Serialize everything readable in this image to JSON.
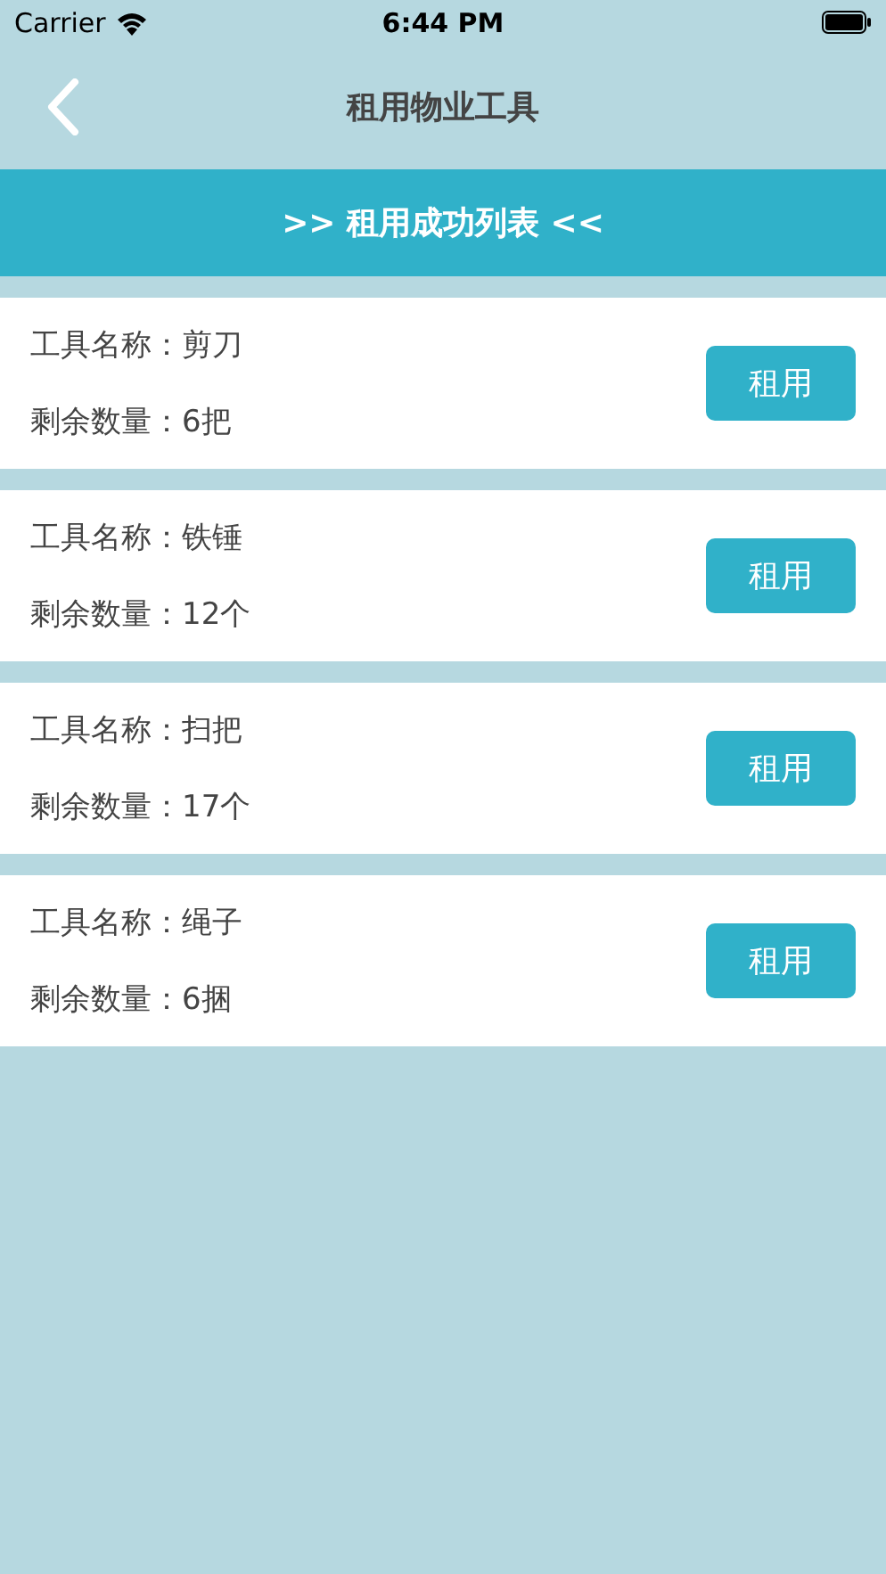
{
  "status_bar": {
    "carrier": "Carrier",
    "time": "6:44 PM"
  },
  "nav": {
    "title": "租用物业工具"
  },
  "banner": {
    "text": ">> 租用成功列表 <<"
  },
  "tools": [
    {
      "name": "工具名称：剪刀",
      "quantity": "剩余数量：6把",
      "button": "租用"
    },
    {
      "name": "工具名称：铁锤",
      "quantity": "剩余数量：12个",
      "button": "租用"
    },
    {
      "name": "工具名称：扫把",
      "quantity": "剩余数量：17个",
      "button": "租用"
    },
    {
      "name": "工具名称：绳子",
      "quantity": "剩余数量：6捆",
      "button": "租用"
    }
  ]
}
